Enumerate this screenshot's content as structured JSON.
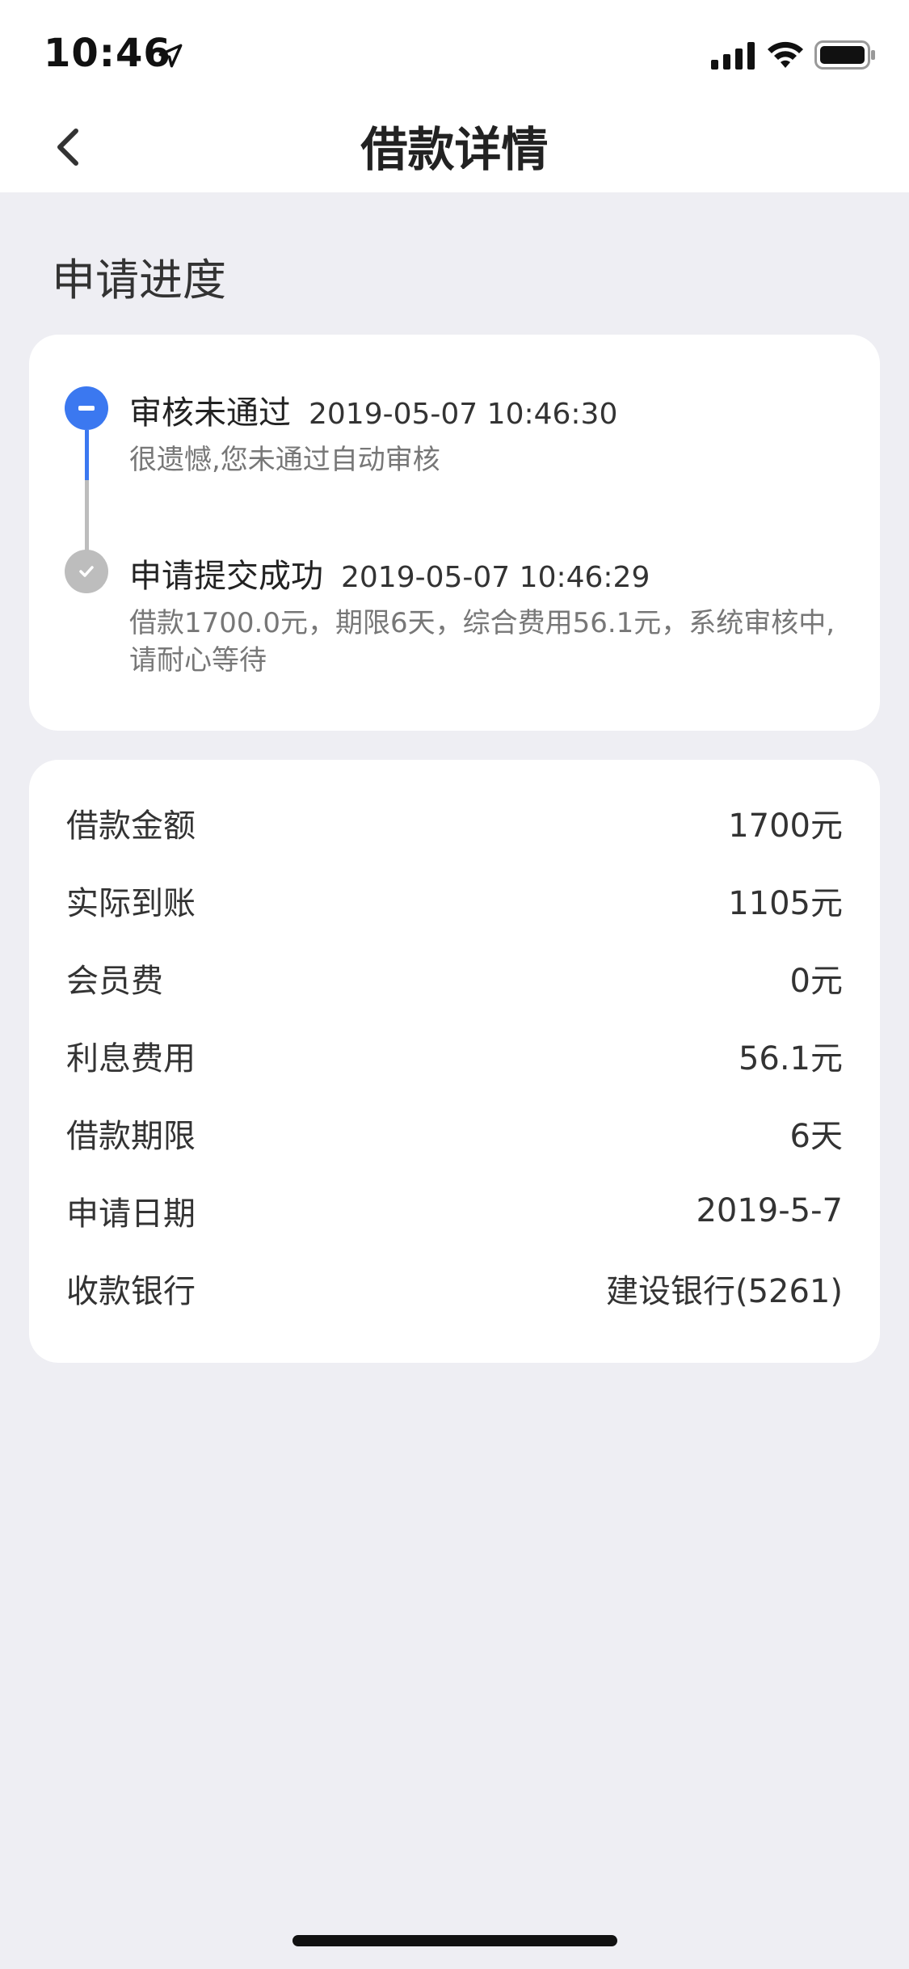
{
  "status_bar": {
    "time": "10:46"
  },
  "nav": {
    "title": "借款详情"
  },
  "progress": {
    "section_title": "申请进度",
    "steps": [
      {
        "title": "审核未通过",
        "time": "2019-05-07 10:46:30",
        "desc": "很遗憾,您未通过自动审核",
        "color": "#3b78f0"
      },
      {
        "title": "申请提交成功",
        "time": "2019-05-07 10:46:29",
        "desc": "借款1700.0元，期限6天，综合费用56.1元，系统审核中,请耐心等待",
        "color": "#bdbdbd"
      }
    ]
  },
  "details": {
    "rows": [
      {
        "label": "借款金额",
        "value": "1700元"
      },
      {
        "label": "实际到账",
        "value": "1105元"
      },
      {
        "label": "会员费",
        "value": "0元"
      },
      {
        "label": "利息费用",
        "value": "56.1元"
      },
      {
        "label": "借款期限",
        "value": "6天"
      },
      {
        "label": "申请日期",
        "value": "2019-5-7"
      },
      {
        "label": "收款银行",
        "value": "建设银行(5261)"
      }
    ]
  }
}
